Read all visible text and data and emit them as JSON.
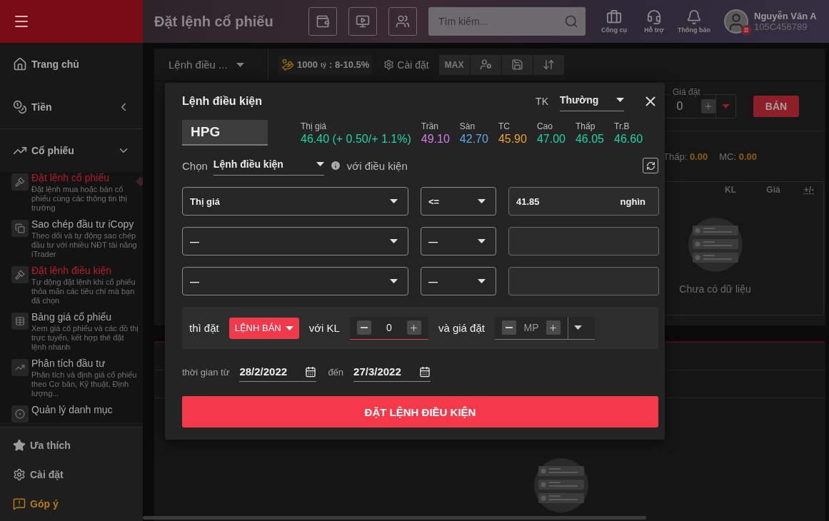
{
  "sidebar": {
    "items": [
      {
        "kind": "link",
        "label": "Trang chủ"
      },
      {
        "kind": "group",
        "label": "Tiền",
        "expanded": false
      },
      {
        "kind": "group",
        "label": "Cổ phiếu",
        "expanded": true,
        "children": [
          {
            "title": "Đặt lệnh cổ phiếu",
            "description": "Đặt lệnh mua hoặc bán cổ phiếu cùng các thông tin thị trường",
            "selected": true,
            "highlighted": true
          },
          {
            "title": "Sao chép đầu tư iCopy",
            "description": "Theo dõi và tự động sao chép đầu tư với nhiều NĐT tài năng iTrader",
            "selected": false,
            "highlighted": false
          },
          {
            "title": "Đặt lệnh điều kiện",
            "description": "Tự động đặt lệnh khi cổ phiếu thỏa mãn các tiêu chí mà bạn đã chọn",
            "selected": false,
            "highlighted": true
          },
          {
            "title": "Bảng giá cổ phiếu",
            "description": "Xem giá cổ phiếu và các đồ thị trực tuyến, kết hợp thẻ đặt lệnh nhanh",
            "selected": false,
            "highlighted": false
          },
          {
            "title": "Phân tích đầu tư",
            "description": "Phân tích và định giá cổ phiếu theo Cơ bản, Kỹ thuật, Định lượng...",
            "selected": false,
            "highlighted": false
          },
          {
            "title": "Quản lý danh mục",
            "selected": false,
            "highlighted": false
          }
        ]
      }
    ],
    "bottom_items": [
      {
        "kind": "favorite",
        "label": "Ưa thích"
      },
      {
        "kind": "settings",
        "label": "Cài đặt"
      },
      {
        "kind": "feedback",
        "label": "Góp ý"
      }
    ]
  },
  "header": {
    "title": "Đặt lệnh cổ phiếu",
    "search": {
      "placeholder": "Tìm kiếm..."
    },
    "tools": [
      {
        "kind": "tools",
        "label": "Công cụ"
      },
      {
        "kind": "support",
        "label": "Hỗ trợ"
      },
      {
        "kind": "notifications",
        "label": "Thông báo"
      }
    ],
    "user": {
      "name": "Nguyễn Văn A",
      "account": "105C456789"
    }
  },
  "order_panel": {
    "order_type": "Lệnh điều ...",
    "margin": {
      "amount": "1000",
      "unit": "tỷ",
      "range": ": 8-10.5%"
    },
    "settings": "Cài đặt",
    "max": "MAX",
    "price_label": "Giá đặt",
    "price": "0",
    "sell": "BÁN",
    "stats": [
      {
        "label": "Thấp:",
        "value": "0.00"
      },
      {
        "label": "MC:",
        "value": "0.00"
      }
    ],
    "table": {
      "columns": [
        "KL",
        "Giá",
        "+/-"
      ],
      "empty": "Chưa có dữ liệu"
    }
  },
  "dialog": {
    "title": "Lệnh điều kiện",
    "account_label": "TK",
    "account": "Thường",
    "symbol": "HPG",
    "quotes": [
      {
        "label": "Thị giá",
        "value": "46.40 (+ 0.50/+ 1.1%)",
        "color": "#1fd3a0"
      },
      {
        "label": "Trần",
        "value": "49.10",
        "color": "#d17ee6"
      },
      {
        "label": "Sàn",
        "value": "42.70",
        "color": "#5ea6e6"
      },
      {
        "label": "TC",
        "value": "45.90",
        "color": "#efa02a"
      },
      {
        "label": "Cao",
        "value": "47.00",
        "color": "#1fd3a0"
      },
      {
        "label": "Thấp",
        "value": "46.05",
        "color": "#1fd3a0"
      },
      {
        "label": "Tr.B",
        "value": "46.60",
        "color": "#1fd3a0"
      }
    ],
    "chooser": {
      "label": "Chọn",
      "value": "Lệnh điều kiện",
      "suffix": "với điều kiện"
    },
    "conditions": [
      {
        "field": "Thị giá",
        "operator": "<=",
        "value": "41.85",
        "unit": "nghìn"
      },
      {
        "field": "—",
        "operator": "—"
      },
      {
        "field": "—",
        "operator": "—"
      }
    ],
    "action": {
      "label": "thì đặt",
      "side": "LỆNH BÁN",
      "quantity_label": "với KL",
      "quantity": "0",
      "price_label": "và giá đặt",
      "price": "MP"
    },
    "dates": {
      "from_label": "thời gian từ",
      "from": "28/2/2022",
      "to_label": "đến",
      "to": "27/3/2022"
    },
    "submit": "ĐẶT LỆNH ĐIỀU KIỆN"
  }
}
